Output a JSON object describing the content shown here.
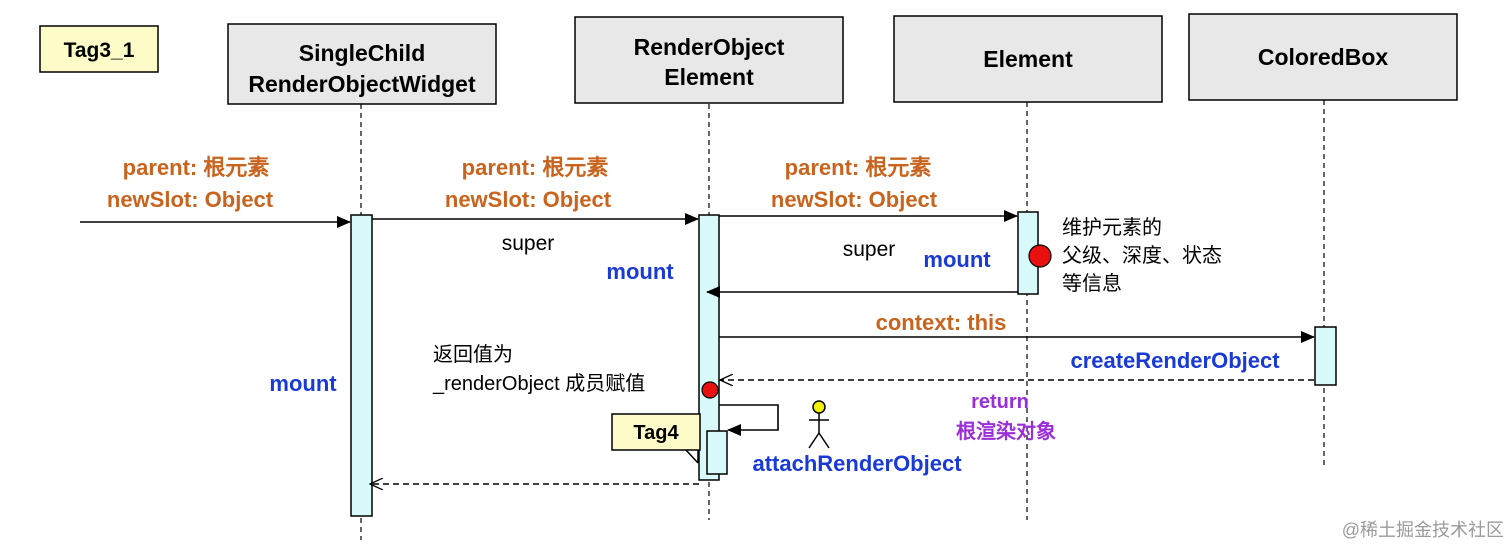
{
  "tag_main": "Tag3_1",
  "tag_sub": "Tag4",
  "participants": [
    {
      "id": "p1",
      "lines": [
        "SingleChild",
        "RenderObjectWidget"
      ]
    },
    {
      "id": "p2",
      "lines": [
        "RenderObject",
        "Element"
      ]
    },
    {
      "id": "p3",
      "lines": [
        "Element"
      ]
    },
    {
      "id": "p4",
      "lines": [
        "ColoredBox"
      ]
    }
  ],
  "messages": {
    "param1": [
      "parent: 根元素",
      "newSlot: Object"
    ],
    "param2": [
      "parent: 根元素",
      "newSlot: Object"
    ],
    "param3": [
      "parent: 根元素",
      "newSlot: Object"
    ],
    "super_1": "super",
    "super_2": "super",
    "mount_p1": "mount",
    "mount_p2": "mount",
    "mount_p3": "mount",
    "element_note": [
      "维护元素的",
      "父级、深度、状态",
      "等信息"
    ],
    "context": "context: this",
    "create": "createRenderObject",
    "return_note": [
      "返回值为",
      "_renderObject 成员赋值"
    ],
    "return_label": [
      "return",
      "根渲染对象"
    ],
    "attach": "attachRenderObject"
  },
  "watermark": "@稀土掘金技术社区",
  "colors": {
    "param": "#c8641e",
    "method": "#1a3ad6",
    "ret": "#9a2ed8",
    "activation": "#d8fafa",
    "header": "#e8e8e8",
    "tag": "#fdfcc8",
    "dot": "#e81010",
    "actor": "#f0f000"
  }
}
